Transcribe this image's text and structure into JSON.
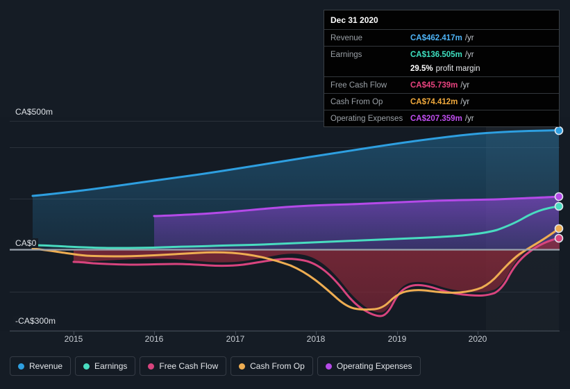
{
  "tooltip": {
    "title": "Dec 31 2020",
    "rows": [
      {
        "label": "Revenue",
        "value": "CA$462.417m",
        "unit": "/yr",
        "color": "#4eb3f5"
      },
      {
        "label": "Earnings",
        "value": "CA$136.505m",
        "unit": "/yr",
        "color": "#3ee0c0"
      },
      {
        "label": "Free Cash Flow",
        "value": "CA$45.739m",
        "unit": "/yr",
        "color": "#e8437f"
      },
      {
        "label": "Cash From Op",
        "value": "CA$74.412m",
        "unit": "/yr",
        "color": "#f0a93c"
      },
      {
        "label": "Operating Expenses",
        "value": "CA$207.359m",
        "unit": "/yr",
        "color": "#c04ef0"
      }
    ],
    "margin_value": "29.5%",
    "margin_label": "profit margin"
  },
  "legend": [
    {
      "label": "Revenue",
      "color": "#2e9fe0"
    },
    {
      "label": "Earnings",
      "color": "#49dcc0"
    },
    {
      "label": "Free Cash Flow",
      "color": "#d8447e"
    },
    {
      "label": "Cash From Op",
      "color": "#eead52"
    },
    {
      "label": "Operating Expenses",
      "color": "#b44ae8"
    }
  ],
  "axis": {
    "y_labels": [
      "CA$500m",
      "CA$0",
      "-CA$300m"
    ],
    "x_labels": [
      "2015",
      "2016",
      "2017",
      "2018",
      "2019",
      "2020"
    ]
  },
  "chart_data": {
    "type": "area",
    "title": "",
    "xlabel": "",
    "ylabel": "CA$",
    "ylim": [
      -300,
      500
    ],
    "y_ticks": [
      500,
      0,
      -300
    ],
    "grid": true,
    "legend_position": "bottom",
    "x": [
      "2014.8",
      "2015.0",
      "2015.25",
      "2015.5",
      "2015.75",
      "2016.0",
      "2016.25",
      "2016.5",
      "2016.75",
      "2017.0",
      "2017.25",
      "2017.5",
      "2017.75",
      "2018.0",
      "2018.25",
      "2018.5",
      "2018.75",
      "2019.0",
      "2019.25",
      "2019.5",
      "2019.75",
      "2020.0",
      "2020.25",
      "2020.5",
      "2020.75",
      "2021.0"
    ],
    "series": [
      {
        "name": "Revenue",
        "color": "#2e9fe0",
        "unit": "CA$m",
        "values": [
          208,
          214,
          220,
          227,
          234,
          243,
          251,
          258,
          266,
          273,
          280,
          288,
          295,
          303,
          312,
          320,
          328,
          337,
          346,
          356,
          367,
          380,
          398,
          420,
          443,
          462.417
        ]
      },
      {
        "name": "Earnings",
        "color": "#49dcc0",
        "unit": "CA$m",
        "values": [
          16,
          14,
          12,
          10,
          8,
          7,
          7,
          8,
          9,
          10,
          11,
          12,
          13,
          14,
          15,
          17,
          19,
          21,
          23,
          25,
          28,
          33,
          48,
          75,
          110,
          136.505
        ]
      },
      {
        "name": "Free Cash Flow",
        "color": "#d8447e",
        "unit": "CA$m",
        "values": [
          null,
          null,
          -50,
          -55,
          -57,
          -58,
          -58,
          -57,
          -52,
          -48,
          -52,
          -62,
          -78,
          -97,
          -135,
          -168,
          -178,
          -190,
          -205,
          -212,
          -198,
          -178,
          -176,
          -120,
          -20,
          45.739
        ]
      },
      {
        "name": "Cash From Op",
        "color": "#eead52",
        "unit": "CA$m",
        "values": [
          2,
          0,
          -6,
          -14,
          -22,
          -26,
          -28,
          -27,
          -22,
          -14,
          -20,
          -34,
          -52,
          -72,
          -112,
          -148,
          -158,
          -170,
          -186,
          -192,
          -178,
          -158,
          -156,
          -100,
          2,
          74.412
        ]
      },
      {
        "name": "Operating Expenses",
        "color": "#b44ae8",
        "unit": "CA$m",
        "values": [
          null,
          null,
          null,
          null,
          null,
          126,
          128,
          130,
          133,
          136,
          139,
          142,
          146,
          152,
          158,
          163,
          166,
          170,
          173,
          176,
          180,
          185,
          191,
          197,
          203,
          207.359
        ]
      }
    ]
  }
}
